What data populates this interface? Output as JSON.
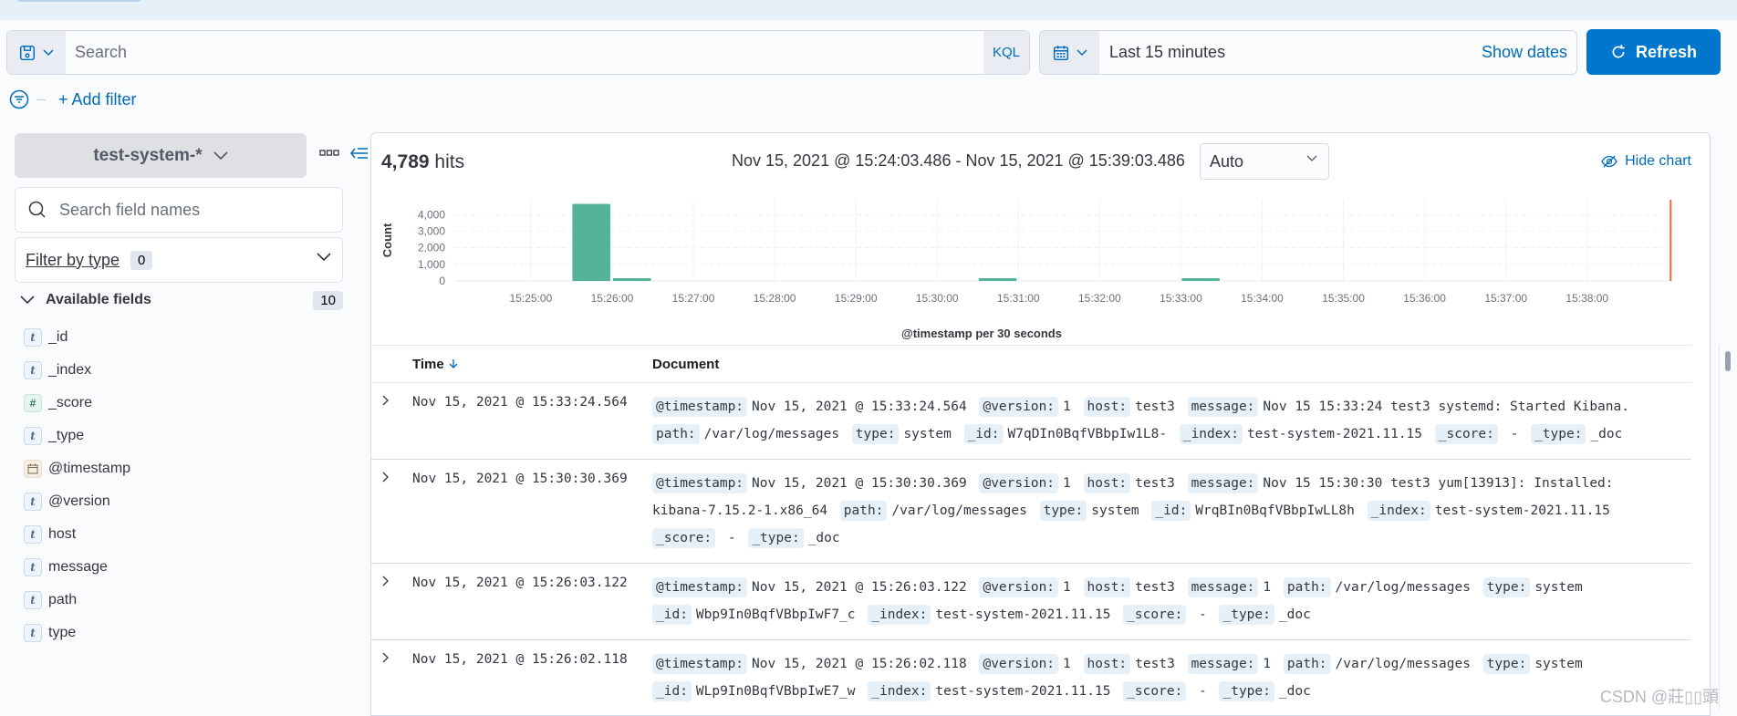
{
  "query_bar": {
    "search_placeholder": "Search",
    "language_label": "KQL"
  },
  "date_picker": {
    "value": "Last 15 minutes",
    "show_dates_label": "Show dates"
  },
  "refresh_button": {
    "label": "Refresh"
  },
  "filters": {
    "add_filter_label": "+ Add filter"
  },
  "sidebar": {
    "index_pattern": "test-system-*",
    "field_search_placeholder": "Search field names",
    "filter_by_type_label": "Filter by type",
    "filter_by_type_count": "0",
    "available_fields_label": "Available fields",
    "available_fields_count": "10",
    "fields": [
      {
        "name": "_id",
        "type": "string",
        "token": "t"
      },
      {
        "name": "_index",
        "type": "string",
        "token": "t"
      },
      {
        "name": "_score",
        "type": "number",
        "token": "#"
      },
      {
        "name": "_type",
        "type": "string",
        "token": "t"
      },
      {
        "name": "@timestamp",
        "type": "date",
        "token": "date-icon"
      },
      {
        "name": "@version",
        "type": "string",
        "token": "t"
      },
      {
        "name": "host",
        "type": "string",
        "token": "t"
      },
      {
        "name": "message",
        "type": "string",
        "token": "t"
      },
      {
        "name": "path",
        "type": "string",
        "token": "t"
      },
      {
        "name": "type",
        "type": "string",
        "token": "t"
      }
    ]
  },
  "results": {
    "hits_count": "4,789",
    "hits_label": "hits",
    "time_range": "Nov 15, 2021 @ 15:24:03.486 - Nov 15, 2021 @ 15:39:03.486",
    "interval": "Auto",
    "hide_chart_label": "Hide chart"
  },
  "chart_data": {
    "type": "bar",
    "title": "",
    "xlabel": "@timestamp per 30 seconds",
    "ylabel": "Count",
    "x_ticks": [
      "15:25:00",
      "15:26:00",
      "15:27:00",
      "15:28:00",
      "15:29:00",
      "15:30:00",
      "15:31:00",
      "15:32:00",
      "15:33:00",
      "15:34:00",
      "15:35:00",
      "15:36:00",
      "15:37:00",
      "15:38:00"
    ],
    "y_ticks": [
      "0",
      "1,000",
      "2,000",
      "3,000",
      "4,000"
    ],
    "ylim": [
      0,
      4900
    ],
    "x_range": [
      "15:24:03.486",
      "15:39:03.486"
    ],
    "bucket_seconds": 30,
    "categories": [
      "15:25:30",
      "15:26:00",
      "15:30:30",
      "15:33:00"
    ],
    "values": [
      4650,
      90,
      25,
      24
    ],
    "now_marker": "15:39:03",
    "bar_color": "#54b399",
    "marker_color": "#e7664c",
    "grid": true
  },
  "table": {
    "columns": [
      "Time",
      "Document"
    ],
    "rows": [
      {
        "time": "Nov 15, 2021 @ 15:33:24.564",
        "fields": [
          {
            "k": "@timestamp:",
            "v": "Nov 15, 2021 @ 15:33:24.564"
          },
          {
            "k": "@version:",
            "v": "1"
          },
          {
            "k": "host:",
            "v": "test3"
          },
          {
            "k": "message:",
            "v": "Nov 15 15:33:24 test3 systemd: Started Kibana."
          },
          {
            "k": "path:",
            "v": "/var/log/messages"
          },
          {
            "k": "type:",
            "v": "system"
          },
          {
            "k": "_id:",
            "v": "W7qDIn0BqfVBbpIw1L8-"
          },
          {
            "k": "_index:",
            "v": "test-system-2021.11.15"
          },
          {
            "k": "_score:",
            "v": " -"
          },
          {
            "k": "_type:",
            "v": "_doc"
          }
        ]
      },
      {
        "time": "Nov 15, 2021 @ 15:30:30.369",
        "fields": [
          {
            "k": "@timestamp:",
            "v": "Nov 15, 2021 @ 15:30:30.369"
          },
          {
            "k": "@version:",
            "v": "1"
          },
          {
            "k": "host:",
            "v": "test3"
          },
          {
            "k": "message:",
            "v": "Nov 15 15:30:30 test3 yum[13913]: Installed: kibana-7.15.2-1.x86_64"
          },
          {
            "k": "path:",
            "v": "/var/log/messages"
          },
          {
            "k": "type:",
            "v": "system"
          },
          {
            "k": "_id:",
            "v": "WrqBIn0BqfVBbpIwLL8h"
          },
          {
            "k": "_index:",
            "v": "test-system-2021.11.15"
          },
          {
            "k": "_score:",
            "v": " -"
          },
          {
            "k": "_type:",
            "v": "_doc"
          }
        ]
      },
      {
        "time": "Nov 15, 2021 @ 15:26:03.122",
        "fields": [
          {
            "k": "@timestamp:",
            "v": "Nov 15, 2021 @ 15:26:03.122"
          },
          {
            "k": "@version:",
            "v": "1"
          },
          {
            "k": "host:",
            "v": "test3"
          },
          {
            "k": "message:",
            "v": "1"
          },
          {
            "k": "path:",
            "v": "/var/log/messages"
          },
          {
            "k": "type:",
            "v": "system"
          },
          {
            "k": "_id:",
            "v": "Wbp9In0BqfVBbpIwF7_c"
          },
          {
            "k": "_index:",
            "v": "test-system-2021.11.15"
          },
          {
            "k": "_score:",
            "v": " -"
          },
          {
            "k": "_type:",
            "v": "_doc"
          }
        ]
      },
      {
        "time": "Nov 15, 2021 @ 15:26:02.118",
        "fields": [
          {
            "k": "@timestamp:",
            "v": "Nov 15, 2021 @ 15:26:02.118"
          },
          {
            "k": "@version:",
            "v": "1"
          },
          {
            "k": "host:",
            "v": "test3"
          },
          {
            "k": "message:",
            "v": "1"
          },
          {
            "k": "path:",
            "v": "/var/log/messages"
          },
          {
            "k": "type:",
            "v": "system"
          },
          {
            "k": "_id:",
            "v": "WLp9In0BqfVBbpIwE7_w"
          },
          {
            "k": "_index:",
            "v": "test-system-2021.11.15"
          },
          {
            "k": "_score:",
            "v": " -"
          },
          {
            "k": "_type:",
            "v": "_doc"
          }
        ]
      }
    ]
  },
  "watermark": "CSDN @莊▯▯頭"
}
